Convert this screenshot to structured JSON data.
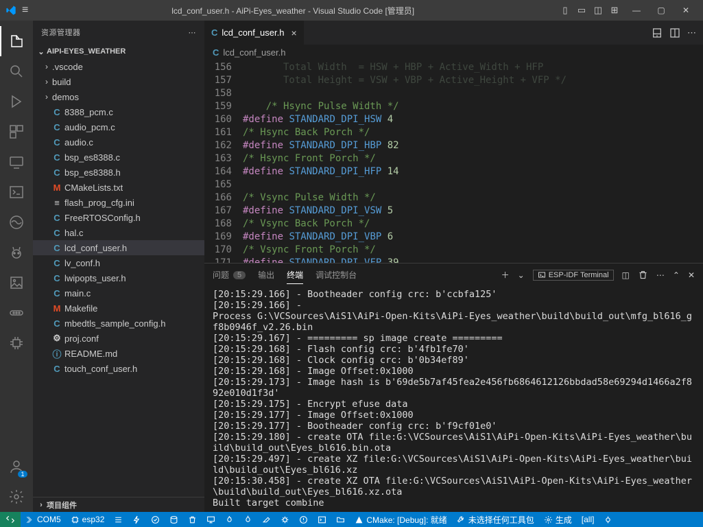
{
  "title": "lcd_conf_user.h - AiPi-Eyes_weather - Visual Studio Code [管理员]",
  "sidebar": {
    "title": "资源管理器",
    "project": "AIPI-EYES_WEATHER",
    "footer": "项目组件",
    "items": [
      {
        "icon": ">",
        "type": "folder",
        "name": ".vscode"
      },
      {
        "icon": ">",
        "type": "folder",
        "name": "build"
      },
      {
        "icon": ">",
        "type": "folder",
        "name": "demos"
      },
      {
        "icon": "C",
        "type": "C",
        "name": "8388_pcm.c"
      },
      {
        "icon": "C",
        "type": "C",
        "name": "audio_pcm.c"
      },
      {
        "icon": "C",
        "type": "C",
        "name": "audio.c"
      },
      {
        "icon": "C",
        "type": "C",
        "name": "bsp_es8388.c"
      },
      {
        "icon": "C",
        "type": "C",
        "name": "bsp_es8388.h"
      },
      {
        "icon": "M",
        "type": "M",
        "name": "CMakeLists.txt"
      },
      {
        "icon": "≡",
        "type": "cfg",
        "name": "flash_prog_cfg.ini"
      },
      {
        "icon": "C",
        "type": "C",
        "name": "FreeRTOSConfig.h"
      },
      {
        "icon": "C",
        "type": "C",
        "name": "hal.c"
      },
      {
        "icon": "C",
        "type": "C",
        "name": "lcd_conf_user.h",
        "selected": true
      },
      {
        "icon": "C",
        "type": "C",
        "name": "lv_conf.h"
      },
      {
        "icon": "C",
        "type": "C",
        "name": "lwipopts_user.h"
      },
      {
        "icon": "C",
        "type": "C",
        "name": "main.c"
      },
      {
        "icon": "M",
        "type": "M",
        "name": "Makefile"
      },
      {
        "icon": "C",
        "type": "C",
        "name": "mbedtls_sample_config.h"
      },
      {
        "icon": "⚙",
        "type": "settings",
        "name": "proj.conf"
      },
      {
        "icon": "ⓘ",
        "type": "info",
        "name": "README.md"
      },
      {
        "icon": "C",
        "type": "C",
        "name": "touch_conf_user.h"
      }
    ]
  },
  "tab": {
    "icon": "C",
    "name": "lcd_conf_user.h"
  },
  "breadcrumb": {
    "icon": "C",
    "name": "lcd_conf_user.h"
  },
  "code": {
    "start": 156,
    "lines": [
      {
        "type": "dimcomment",
        "text": "       Total Width  = HSW + HBP + Active_Width + HFP"
      },
      {
        "type": "dimcomment",
        "text": "       Total Height = VSW + VBP + Active_Height + VFP */"
      },
      {
        "type": "blank",
        "text": ""
      },
      {
        "type": "comment",
        "text": "    /* Hsync Pulse Width */"
      },
      {
        "type": "define",
        "macro": "STANDARD_DPI_HSW",
        "val": "4"
      },
      {
        "type": "comment",
        "text": "/* Hsync Back Porch */"
      },
      {
        "type": "define",
        "macro": "STANDARD_DPI_HBP",
        "val": "82"
      },
      {
        "type": "comment",
        "text": "/* Hsync Front Porch */"
      },
      {
        "type": "define",
        "macro": "STANDARD_DPI_HFP",
        "val": "14"
      },
      {
        "type": "blank",
        "text": ""
      },
      {
        "type": "comment",
        "text": "/* Vsync Pulse Width */"
      },
      {
        "type": "define",
        "macro": "STANDARD_DPI_VSW",
        "val": "5"
      },
      {
        "type": "comment",
        "text": "/* Vsync Back Porch */"
      },
      {
        "type": "define",
        "macro": "STANDARD_DPI_VBP",
        "val": "6"
      },
      {
        "type": "comment",
        "text": "/* Vsync Front Porch */"
      },
      {
        "type": "define",
        "macro": "STANDARD_DPI_VFP",
        "val": "39"
      }
    ]
  },
  "panel": {
    "tabs": {
      "problems": "问题",
      "problems_count": "5",
      "output": "输出",
      "terminal": "终端",
      "debug": "调试控制台"
    },
    "esp_label": "ESP-IDF Terminal",
    "terminal": "[20:15:29.166] - Bootheader config crc: b'ccbfa125'\n[20:15:29.166] - \nProcess G:\\VCSources\\AiS1\\AiPi-Open-Kits\\AiPi-Eyes_weather\\build\\build_out\\mfg_bl616_gf8b0946f_v2.26.bin\n[20:15:29.167] - ========= sp image create =========\n[20:15:29.168] - Flash config crc: b'4fb1fe70'\n[20:15:29.168] - Clock config crc: b'0b34ef89'\n[20:15:29.168] - Image Offset:0x1000\n[20:15:29.173] - Image hash is b'69de5b7af45fea2e456fb6864612126bbdad58e69294d1466a2f892e010d1f3d'\n[20:15:29.175] - Encrypt efuse data\n[20:15:29.177] - Image Offset:0x1000\n[20:15:29.177] - Bootheader config crc: b'f9cf01e0'\n[20:15:29.180] - create OTA file:G:\\VCSources\\AiS1\\AiPi-Open-Kits\\AiPi-Eyes_weather\\build\\build_out\\Eyes_bl616.bin.ota\n[20:15:29.497] - create XZ file:G:\\VCSources\\AiS1\\AiPi-Open-Kits\\AiPi-Eyes_weather\\build\\build_out\\Eyes_bl616.xz\n[20:15:30.458] - create XZ OTA file:G:\\VCSources\\AiS1\\AiPi-Open-Kits\\AiPi-Eyes_weather\\build\\build_out\\Eyes_bl616.xz.ota\nBuilt target combine"
  },
  "status": {
    "com": "COM5",
    "target": "esp32",
    "cmake": "CMake: [Debug]: 就绪",
    "toolkit": "未选择任何工具包",
    "build": "生成",
    "all": "[all]"
  },
  "accounts_badge": "1"
}
